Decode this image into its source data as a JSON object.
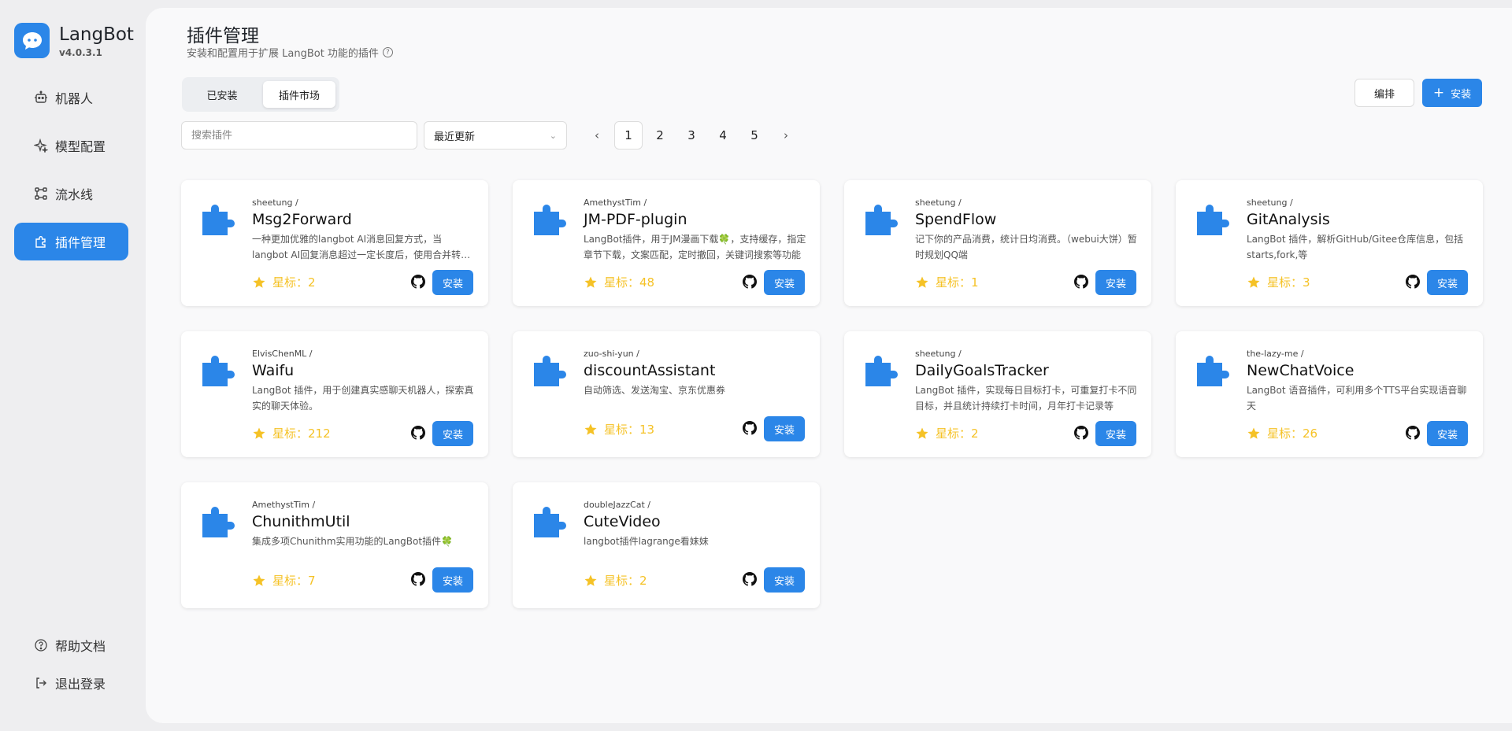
{
  "brand": {
    "name": "LangBot",
    "version": "v4.0.3.1"
  },
  "sidebar": {
    "items": [
      {
        "label": "机器人",
        "icon": "robot-icon"
      },
      {
        "label": "模型配置",
        "icon": "sparkle-icon"
      },
      {
        "label": "流水线",
        "icon": "pipeline-icon"
      },
      {
        "label": "插件管理",
        "icon": "plugin-icon"
      }
    ],
    "bottom": [
      {
        "label": "帮助文档",
        "icon": "help-icon"
      },
      {
        "label": "退出登录",
        "icon": "logout-icon"
      }
    ]
  },
  "page": {
    "title": "插件管理",
    "subtitle": "安装和配置用于扩展 LangBot 功能的插件"
  },
  "tabs": [
    {
      "label": "已安装"
    },
    {
      "label": "插件市场"
    }
  ],
  "toolbar": {
    "arrange_label": "编排",
    "install_label": "安装"
  },
  "search": {
    "placeholder": "搜索插件",
    "value": ""
  },
  "sort": {
    "value": "最近更新"
  },
  "pagination": {
    "pages": [
      "1",
      "2",
      "3",
      "4",
      "5"
    ],
    "current": "1"
  },
  "colors": {
    "accent": "#2b86e8",
    "star": "#f5c226",
    "background": "#eeeef0"
  },
  "plugins": [
    {
      "author": "sheetung /",
      "name": "Msg2Forward",
      "desc": "一种更加优雅的langbot AI消息回复方式，当langbot AI回复消息超过一定长度后，使用合并转发的方式发送消息",
      "stars": "星标：2",
      "install": "安装"
    },
    {
      "author": "AmethystTim /",
      "name": "JM-PDF-plugin",
      "desc": "LangBot插件，用于JM漫画下载🍀，支持缓存，指定章节下载，文案匹配，定时撤回，关键词搜索等功能",
      "stars": "星标：48",
      "install": "安装"
    },
    {
      "author": "sheetung /",
      "name": "SpendFlow",
      "desc": "记下你的产品消费，统计日均消费。（webui大饼）暂时规划QQ端",
      "stars": "星标：1",
      "install": "安装"
    },
    {
      "author": "sheetung /",
      "name": "GitAnalysis",
      "desc": "LangBot 插件，解析GitHub/Gitee仓库信息，包括starts,fork,等",
      "stars": "星标：3",
      "install": "安装"
    },
    {
      "author": "ElvisChenML /",
      "name": "Waifu",
      "desc": "LangBot 插件，用于创建真实感聊天机器人，探索真实的聊天体验。",
      "stars": "星标：212",
      "install": "安装"
    },
    {
      "author": "zuo-shi-yun /",
      "name": "discountAssistant",
      "desc": "自动筛选、发送淘宝、京东优惠券",
      "stars": "星标：13",
      "install": "安装"
    },
    {
      "author": "sheetung /",
      "name": "DailyGoalsTracker",
      "desc": "LangBot 插件，实现每日目标打卡，可重复打卡不同目标，并且统计持续打卡时间，月年打卡记录等",
      "stars": "星标：2",
      "install": "安装"
    },
    {
      "author": "the-lazy-me /",
      "name": "NewChatVoice",
      "desc": "LangBot 语音插件，可利用多个TTS平台实现语音聊天",
      "stars": "星标：26",
      "install": "安装"
    },
    {
      "author": "AmethystTim /",
      "name": "ChunithmUtil",
      "desc": "集成多项Chunithm实用功能的LangBot插件🍀",
      "stars": "星标：7",
      "install": "安装"
    },
    {
      "author": "doubleJazzCat /",
      "name": "CuteVideo",
      "desc": "langbot插件lagrange看妹妹",
      "stars": "星标：2",
      "install": "安装"
    }
  ]
}
